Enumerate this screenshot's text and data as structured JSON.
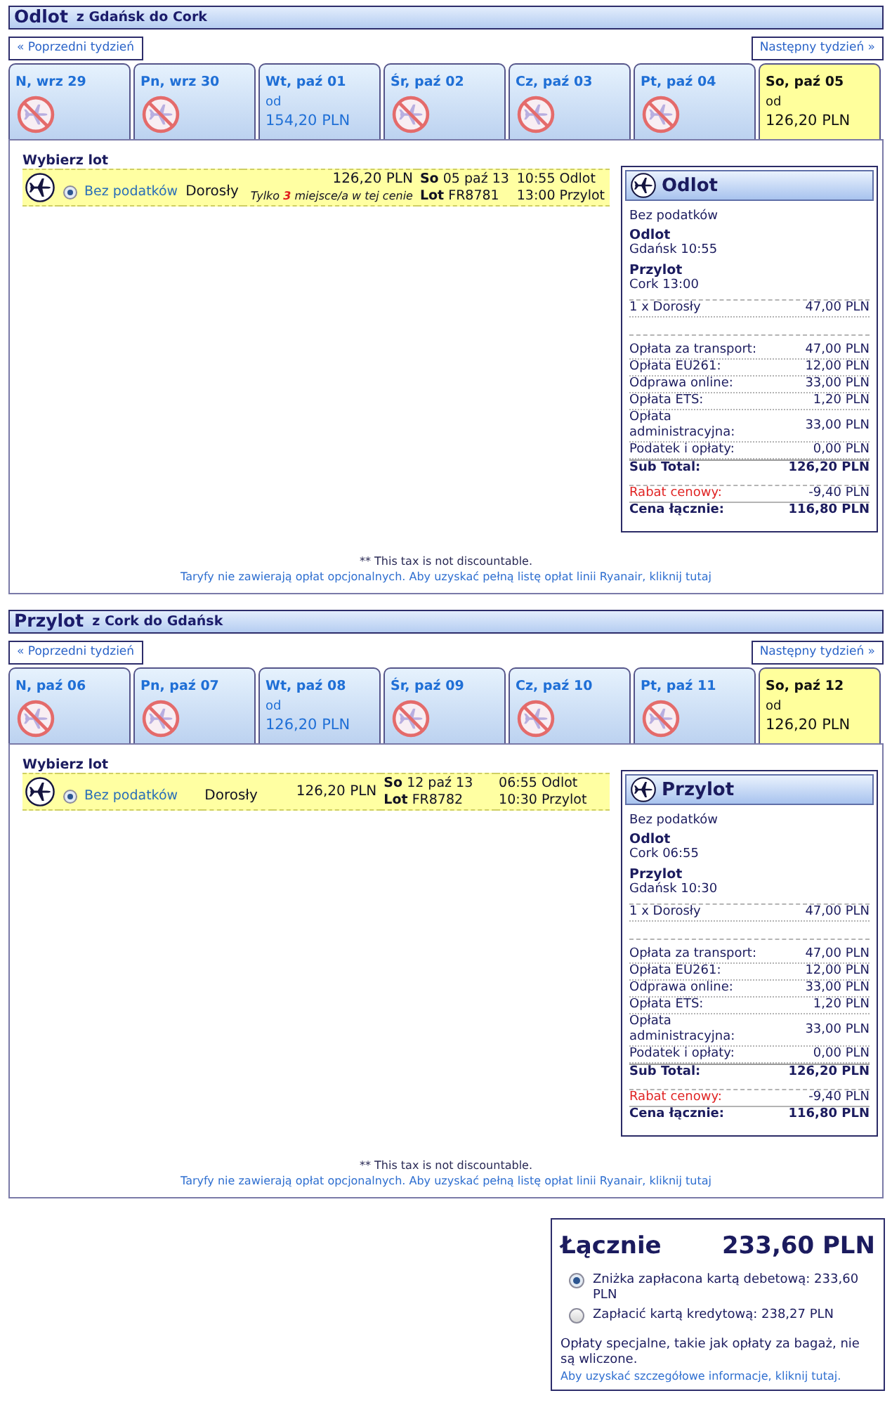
{
  "sections": [
    {
      "title": "Odlot",
      "route": "z Gdańsk do Cork",
      "prev_week": "« Poprzedni tydzień",
      "next_week": "Następny tydzień »",
      "days": [
        {
          "label": "N, wrz 29",
          "kind": "no_flight",
          "selected": false
        },
        {
          "label": "Pn, wrz 30",
          "kind": "no_flight",
          "selected": false
        },
        {
          "label": "Wt, paź 01",
          "kind": "fare",
          "from": "od",
          "price": "154,20 PLN",
          "selected": false
        },
        {
          "label": "Śr, paź 02",
          "kind": "no_flight",
          "selected": false
        },
        {
          "label": "Cz, paź 03",
          "kind": "no_flight",
          "selected": false
        },
        {
          "label": "Pt, paź 04",
          "kind": "no_flight",
          "selected": false
        },
        {
          "label": "So, paź 05",
          "kind": "fare",
          "from": "od",
          "price": "126,20 PLN",
          "selected": true
        }
      ],
      "choose_label": "Wybierz lot",
      "flight": {
        "selected": true,
        "fare_type": "Bez podatków",
        "passenger": "Dorosły",
        "price": "126,20 PLN",
        "seats_note": "Tylko **3** miejsce/a w tej cenie",
        "date": "**So** 05 paź 13",
        "flight_no": "**Lot** FR8781",
        "departure": "10:55 Odlot",
        "arrival": "13:00 Przylot"
      },
      "summary": {
        "title": "Odlot",
        "fare_type": "Bez podatków",
        "departure_label": "Odlot",
        "departure": "Gdańsk 10:55",
        "arrival_label": "Przylot",
        "arrival": "Cork 13:00",
        "passengers": [
          {
            "label": "1 x Dorosły",
            "amount": "47,00 PLN"
          }
        ],
        "fees": [
          {
            "label": "Opłata za transport:",
            "amount": "47,00 PLN"
          },
          {
            "label": "Opłata EU261:",
            "amount": "12,00 PLN"
          },
          {
            "label": "Odprawa online:",
            "amount": "33,00 PLN"
          },
          {
            "label": "Opłata ETS:",
            "amount": "1,20 PLN"
          },
          {
            "label": "Opłata administracyjna:",
            "amount": "33,00 PLN"
          },
          {
            "label": "Podatek i opłaty:",
            "amount": "0,00 PLN"
          }
        ],
        "subtotal": {
          "label": "Sub Total:",
          "amount": "126,20 PLN"
        },
        "discount": {
          "label": "Rabat cenowy:",
          "amount": "-9,40 PLN"
        },
        "total": {
          "label": "Cena łącznie:",
          "amount": "116,80 PLN"
        }
      },
      "footnote": "** This tax is not discountable.",
      "fees_link": "Taryfy nie zawierają opłat opcjonalnych. Aby uzyskać pełną listę opłat linii Ryanair, kliknij tutaj"
    },
    {
      "title": "Przylot",
      "route": "z Cork do Gdańsk",
      "prev_week": "« Poprzedni tydzień",
      "next_week": "Następny tydzień »",
      "days": [
        {
          "label": "N, paź 06",
          "kind": "no_flight",
          "selected": false
        },
        {
          "label": "Pn, paź 07",
          "kind": "no_flight",
          "selected": false
        },
        {
          "label": "Wt, paź 08",
          "kind": "fare",
          "from": "od",
          "price": "126,20 PLN",
          "selected": false
        },
        {
          "label": "Śr, paź 09",
          "kind": "no_flight",
          "selected": false
        },
        {
          "label": "Cz, paź 10",
          "kind": "no_flight",
          "selected": false
        },
        {
          "label": "Pt, paź 11",
          "kind": "no_flight",
          "selected": false
        },
        {
          "label": "So, paź 12",
          "kind": "fare",
          "from": "od",
          "price": "126,20 PLN",
          "selected": true
        }
      ],
      "choose_label": "Wybierz lot",
      "flight": {
        "selected": true,
        "fare_type": "Bez podatków",
        "passenger": "Dorosły",
        "price": "126,20 PLN",
        "date": "**So** 12 paź 13",
        "flight_no": "**Lot** FR8782",
        "departure": "06:55 Odlot",
        "arrival": "10:30 Przylot"
      },
      "summary": {
        "title": "Przylot",
        "fare_type": "Bez podatków",
        "departure_label": "Odlot",
        "departure": "Cork 06:55",
        "arrival_label": "Przylot",
        "arrival": "Gdańsk 10:30",
        "passengers": [
          {
            "label": "1 x Dorosły",
            "amount": "47,00 PLN"
          }
        ],
        "fees": [
          {
            "label": "Opłata za transport:",
            "amount": "47,00 PLN"
          },
          {
            "label": "Opłata EU261:",
            "amount": "12,00 PLN"
          },
          {
            "label": "Odprawa online:",
            "amount": "33,00 PLN"
          },
          {
            "label": "Opłata ETS:",
            "amount": "1,20 PLN"
          },
          {
            "label": "Opłata administracyjna:",
            "amount": "33,00 PLN"
          },
          {
            "label": "Podatek i opłaty:",
            "amount": "0,00 PLN"
          }
        ],
        "subtotal": {
          "label": "Sub Total:",
          "amount": "126,20 PLN"
        },
        "discount": {
          "label": "Rabat cenowy:",
          "amount": "-9,40 PLN"
        },
        "total": {
          "label": "Cena łącznie:",
          "amount": "116,80 PLN"
        }
      },
      "footnote": "** This tax is not discountable.",
      "fees_link": "Taryfy nie zawierają opłat opcjonalnych. Aby uzyskać pełną listę opłat linii Ryanair, kliknij tutaj"
    }
  ],
  "total": {
    "label": "Łącznie",
    "amount": "233,60 PLN",
    "payment_options": [
      {
        "label": "Zniżka zapłacona kartą debetową: 233,60 PLN",
        "selected": true
      },
      {
        "label": "Zapłacić kartą kredytową: 238,27 PLN",
        "selected": false
      }
    ],
    "note": "Opłaty specjalne, takie jak opłaty za bagaż, nie są wliczone.",
    "note_link": "Aby uzyskać szczegółowe informacje, kliknij tutaj."
  }
}
